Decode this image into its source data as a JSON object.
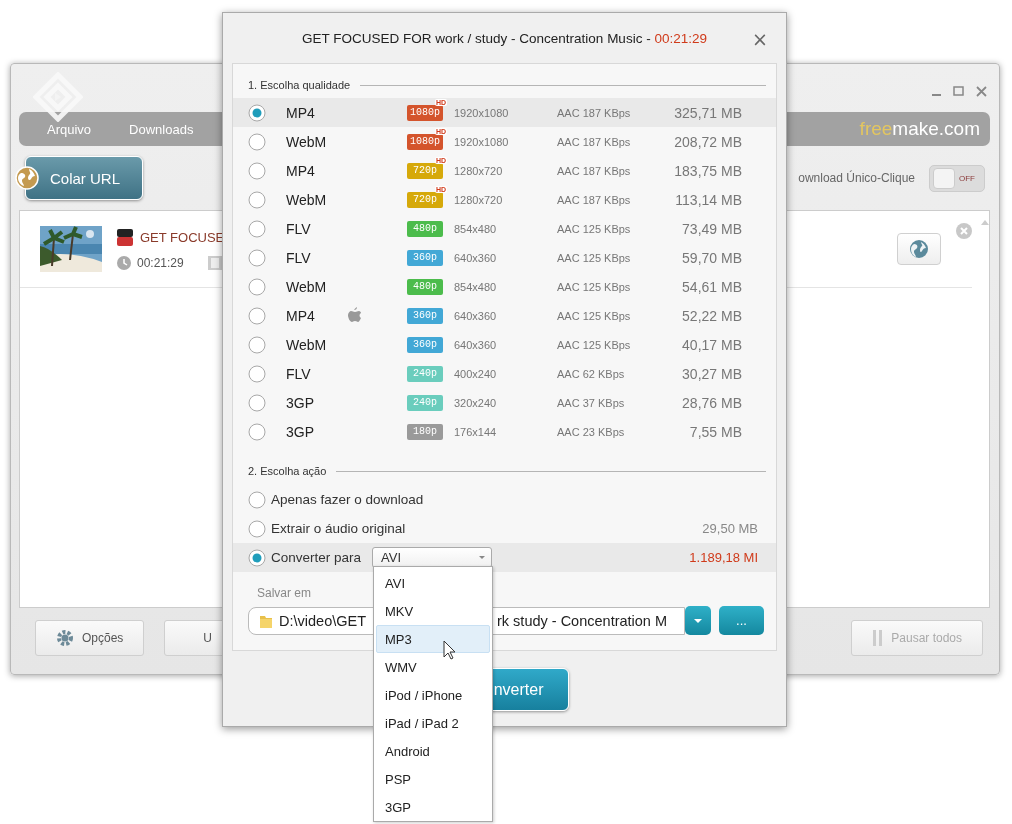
{
  "window": {
    "menu": [
      "Arquivo",
      "Downloads"
    ],
    "brand": {
      "accent": "free",
      "rest": "make.com"
    },
    "paste_button": "Colar URL",
    "one_click": {
      "label": "ownload Único-Clique",
      "state": "OFF",
      "on": false
    },
    "download": {
      "title": "GET FOCUSE",
      "duration": "00:21:29"
    },
    "footer_buttons": [
      {
        "label": "Opções",
        "kind": "options",
        "disabled": false
      },
      {
        "label": "U",
        "kind": "plain",
        "disabled": false
      },
      {
        "label": "Pausar todos",
        "kind": "pause",
        "disabled": true
      }
    ]
  },
  "dialog": {
    "title": "GET FOCUSED FOR work / study - Concentration Music - ",
    "time": "00:21:29",
    "close": "×",
    "quality_heading": "1. Escolha qualidade",
    "rows": [
      {
        "format": "MP4",
        "badge": "1080p",
        "color": "#d4542c",
        "hd_label": "HD",
        "device_icon": false,
        "resolution": "1920x1080",
        "audio": "AAC 187 KBps",
        "size": "325,71 MB",
        "selected": true
      },
      {
        "format": "WebM",
        "badge": "1080p",
        "color": "#d4542c",
        "hd_label": "HD",
        "device_icon": false,
        "resolution": "1920x1080",
        "audio": "AAC 187 KBps",
        "size": "208,72 MB",
        "selected": false
      },
      {
        "format": "MP4",
        "badge": "720p",
        "color": "#d6a90a",
        "hd_label": "HD",
        "device_icon": false,
        "resolution": "1280x720",
        "audio": "AAC 187 KBps",
        "size": "183,75 MB",
        "selected": false
      },
      {
        "format": "WebM",
        "badge": "720p",
        "color": "#d6a90a",
        "hd_label": "HD",
        "device_icon": false,
        "resolution": "1280x720",
        "audio": "AAC 187 KBps",
        "size": "113,14 MB",
        "selected": false
      },
      {
        "format": "FLV",
        "badge": "480p",
        "color": "#4cbc4c",
        "device_icon": false,
        "resolution": "854x480",
        "audio": "AAC 125 KBps",
        "size": "73,49 MB",
        "selected": false
      },
      {
        "format": "FLV",
        "badge": "360p",
        "color": "#42a8d6",
        "device_icon": false,
        "resolution": "640x360",
        "audio": "AAC 125 KBps",
        "size": "59,70 MB",
        "selected": false
      },
      {
        "format": "WebM",
        "badge": "480p",
        "color": "#4cbc4c",
        "device_icon": false,
        "resolution": "854x480",
        "audio": "AAC 125 KBps",
        "size": "54,61 MB",
        "selected": false
      },
      {
        "format": "MP4",
        "badge": "360p",
        "color": "#42a8d6",
        "device_icon": true,
        "resolution": "640x360",
        "audio": "AAC 125 KBps",
        "size": "52,22 MB",
        "selected": false
      },
      {
        "format": "WebM",
        "badge": "360p",
        "color": "#42a8d6",
        "device_icon": false,
        "resolution": "640x360",
        "audio": "AAC 125 KBps",
        "size": "40,17 MB",
        "selected": false
      },
      {
        "format": "FLV",
        "badge": "240p",
        "color": "#6acdbd",
        "device_icon": false,
        "resolution": "400x240",
        "audio": "AAC 62 KBps",
        "size": "30,27 MB",
        "selected": false
      },
      {
        "format": "3GP",
        "badge": "240p",
        "color": "#6acdbd",
        "device_icon": false,
        "resolution": "320x240",
        "audio": "AAC 37 KBps",
        "size": "28,76 MB",
        "selected": false
      },
      {
        "format": "3GP",
        "badge": "180p",
        "color": "#9a9a9a",
        "device_icon": false,
        "resolution": "176x144",
        "audio": "AAC 23 KBps",
        "size": "7,55 MB",
        "selected": false
      }
    ],
    "action_heading": "2. Escolha ação",
    "actions": [
      {
        "kind": "plain",
        "label": "Apenas fazer o download",
        "selected": false
      },
      {
        "kind": "plain",
        "label": "Extrair o áudio original",
        "size": "29,50 MB",
        "selected": false
      },
      {
        "kind": "convert",
        "label": "Converter para",
        "select": "AVI",
        "size": "1.189,18 MI",
        "selected": true
      }
    ],
    "save_label": "Salvar em",
    "path_start": "D:\\video\\GET",
    "path_end": "rk   study - Concentration M",
    "browse": "...",
    "convert_button": "nverter"
  },
  "menu": {
    "items": [
      {
        "label": "AVI",
        "selected": false
      },
      {
        "label": "MKV",
        "selected": false
      },
      {
        "label": "MP3",
        "selected": true
      },
      {
        "label": "WMV",
        "selected": false
      },
      {
        "label": "iPod / iPhone",
        "selected": false
      },
      {
        "label": "iPad / iPad 2",
        "selected": false
      },
      {
        "label": "Android",
        "selected": false
      },
      {
        "label": "PSP",
        "selected": false
      },
      {
        "label": "3GP",
        "selected": false
      }
    ]
  }
}
